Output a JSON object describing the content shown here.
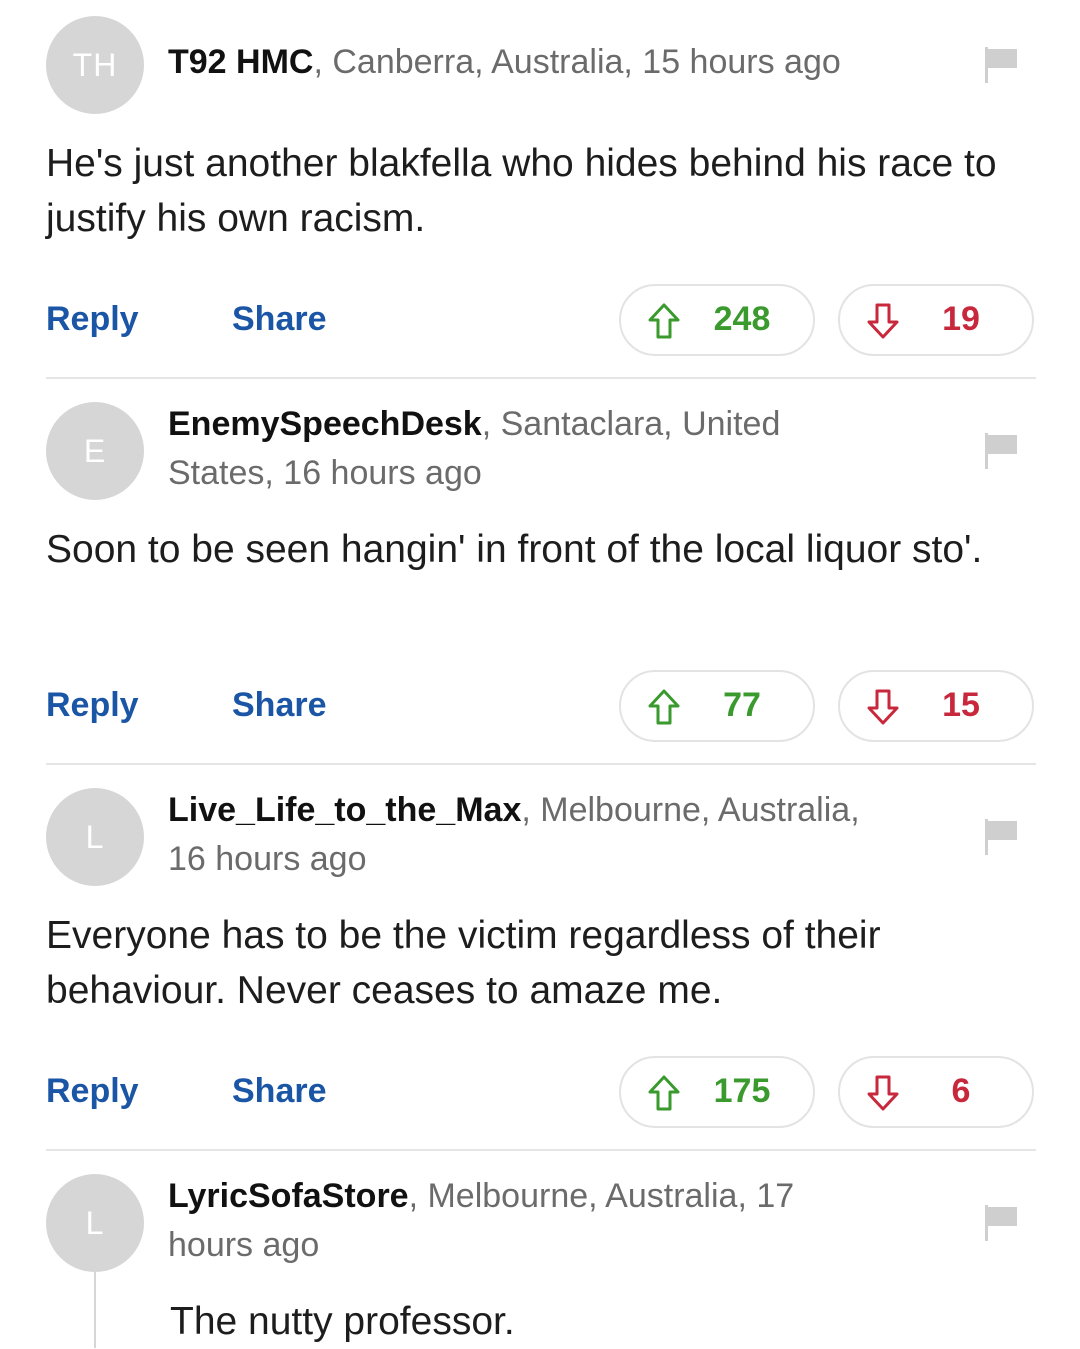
{
  "comments": [
    {
      "avatar_initials": "TH",
      "username": "T92 HMC",
      "meta_line1": ", Canberra, Australia, 15 hours ago",
      "meta_line2": "",
      "text": "He's just another blakfella who hides behind his race to justify his own racism.",
      "reply_label": "Reply",
      "share_label": "Share",
      "upvotes": "248",
      "downvotes": "19"
    },
    {
      "avatar_initials": "E",
      "username": "EnemySpeechDesk",
      "meta_line1": ", Santaclara, United",
      "meta_line2": "States, 16 hours ago",
      "text": "Soon to be seen hangin' in front of the local liquor sto'.",
      "reply_label": "Reply",
      "share_label": "Share",
      "upvotes": "77",
      "downvotes": "15"
    },
    {
      "avatar_initials": "L",
      "username": "Live_Life_to_the_Max",
      "meta_line1": ", Melbourne, Australia,",
      "meta_line2": "16 hours ago",
      "text": "Everyone has to be the victim regardless of their behaviour. Never ceases to amaze me.",
      "reply_label": "Reply",
      "share_label": "Share",
      "upvotes": "175",
      "downvotes": "6"
    },
    {
      "avatar_initials": "L",
      "username": "LyricSofaStore",
      "meta_line1": ", Melbourne, Australia, 17",
      "meta_line2": "hours ago",
      "text": "The nutty professor."
    }
  ],
  "colors": {
    "link": "#1b55a5",
    "upvote": "#3a9a2e",
    "downvote": "#c8283c",
    "avatar_bg": "#d6d6d6",
    "flag": "#cfcfcf"
  },
  "icons": {
    "flag": "flag-icon",
    "upvote": "arrow-up-icon",
    "downvote": "arrow-down-icon"
  }
}
